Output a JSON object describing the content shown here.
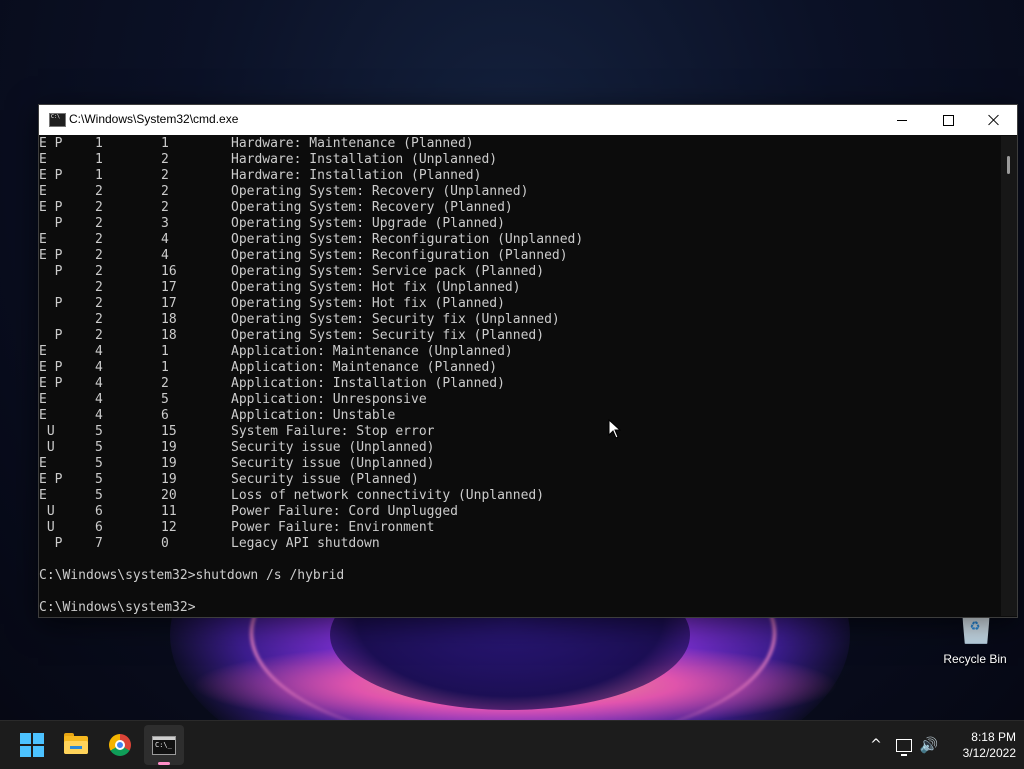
{
  "desktop": {
    "recycle_bin_label": "Recycle Bin"
  },
  "window": {
    "title": "C:\\Windows\\System32\\cmd.exe",
    "icon": "cmd-icon",
    "controls": {
      "minimize": "minimize-icon",
      "maximize": "maximize-icon",
      "close": "close-icon"
    }
  },
  "console": {
    "rows": [
      {
        "flags": "E P",
        "major": "1",
        "minor": "1",
        "reason": "Hardware: Maintenance (Planned)"
      },
      {
        "flags": "E",
        "major": "1",
        "minor": "2",
        "reason": "Hardware: Installation (Unplanned)"
      },
      {
        "flags": "E P",
        "major": "1",
        "minor": "2",
        "reason": "Hardware: Installation (Planned)"
      },
      {
        "flags": "E",
        "major": "2",
        "minor": "2",
        "reason": "Operating System: Recovery (Unplanned)"
      },
      {
        "flags": "E P",
        "major": "2",
        "minor": "2",
        "reason": "Operating System: Recovery (Planned)"
      },
      {
        "flags": "  P",
        "major": "2",
        "minor": "3",
        "reason": "Operating System: Upgrade (Planned)"
      },
      {
        "flags": "E",
        "major": "2",
        "minor": "4",
        "reason": "Operating System: Reconfiguration (Unplanned)"
      },
      {
        "flags": "E P",
        "major": "2",
        "minor": "4",
        "reason": "Operating System: Reconfiguration (Planned)"
      },
      {
        "flags": "  P",
        "major": "2",
        "minor": "16",
        "reason": "Operating System: Service pack (Planned)"
      },
      {
        "flags": "",
        "major": "2",
        "minor": "17",
        "reason": "Operating System: Hot fix (Unplanned)"
      },
      {
        "flags": "  P",
        "major": "2",
        "minor": "17",
        "reason": "Operating System: Hot fix (Planned)"
      },
      {
        "flags": "",
        "major": "2",
        "minor": "18",
        "reason": "Operating System: Security fix (Unplanned)"
      },
      {
        "flags": "  P",
        "major": "2",
        "minor": "18",
        "reason": "Operating System: Security fix (Planned)"
      },
      {
        "flags": "E",
        "major": "4",
        "minor": "1",
        "reason": "Application: Maintenance (Unplanned)"
      },
      {
        "flags": "E P",
        "major": "4",
        "minor": "1",
        "reason": "Application: Maintenance (Planned)"
      },
      {
        "flags": "E P",
        "major": "4",
        "minor": "2",
        "reason": "Application: Installation (Planned)"
      },
      {
        "flags": "E",
        "major": "4",
        "minor": "5",
        "reason": "Application: Unresponsive"
      },
      {
        "flags": "E",
        "major": "4",
        "minor": "6",
        "reason": "Application: Unstable"
      },
      {
        "flags": " U",
        "major": "5",
        "minor": "15",
        "reason": "System Failure: Stop error"
      },
      {
        "flags": " U",
        "major": "5",
        "minor": "19",
        "reason": "Security issue (Unplanned)"
      },
      {
        "flags": "E",
        "major": "5",
        "minor": "19",
        "reason": "Security issue (Unplanned)"
      },
      {
        "flags": "E P",
        "major": "5",
        "minor": "19",
        "reason": "Security issue (Planned)"
      },
      {
        "flags": "E",
        "major": "5",
        "minor": "20",
        "reason": "Loss of network connectivity (Unplanned)"
      },
      {
        "flags": " U",
        "major": "6",
        "minor": "11",
        "reason": "Power Failure: Cord Unplugged"
      },
      {
        "flags": " U",
        "major": "6",
        "minor": "12",
        "reason": "Power Failure: Environment"
      },
      {
        "flags": "  P",
        "major": "7",
        "minor": "0",
        "reason": "Legacy API shutdown"
      }
    ],
    "command_line": "C:\\Windows\\system32>shutdown /s /hybrid",
    "current_prompt": "C:\\Windows\\system32>"
  },
  "taskbar": {
    "items": [
      {
        "name": "start-button",
        "icon": "windows-logo-icon"
      },
      {
        "name": "file-explorer-button",
        "icon": "folder-icon"
      },
      {
        "name": "chrome-button",
        "icon": "chrome-icon"
      },
      {
        "name": "command-prompt-button",
        "icon": "cmd-icon",
        "active": true
      }
    ],
    "tray": {
      "chevron": "^",
      "time": "8:18 PM",
      "date": "3/12/2022"
    }
  }
}
